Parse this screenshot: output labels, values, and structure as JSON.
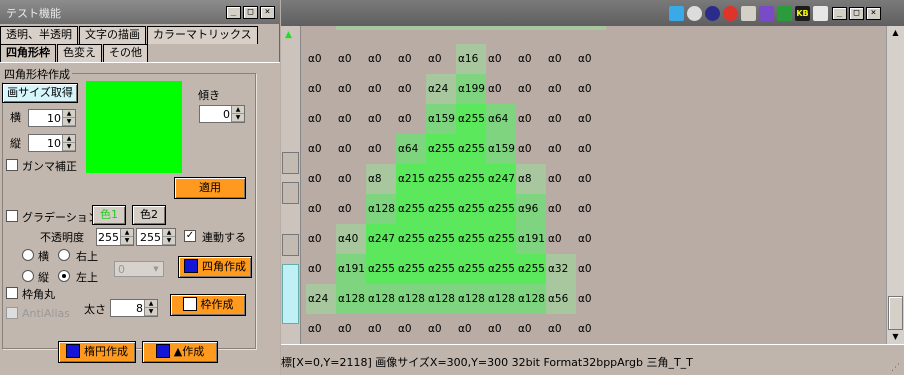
{
  "tool_window": {
    "title": "テスト機能",
    "tabs_row1": [
      "透明、半透明",
      "文字の描画",
      "カラーマトリックス"
    ],
    "tabs_row2": [
      "四角形枠",
      "色変え",
      "その他"
    ],
    "group_title": "四角形枠作成",
    "image_size_button": "画サイズ取得",
    "tilt_label": "傾き",
    "tilt_value": "0",
    "width_label": "横",
    "width_value": "10",
    "height_label": "縦",
    "height_value": "10",
    "gamma_label": "ガンマ補正",
    "apply_button": "適用",
    "gradation_label": "グラデーション",
    "color1_button": "色1",
    "color2_button": "色2",
    "opacity_label": "不透明度",
    "opacity1": "255",
    "opacity2": "255",
    "linked_label": "連動する",
    "dir_horizontal": "横",
    "dir_upper_right": "右上",
    "dir_vertical": "縦",
    "dir_upper_left": "左上",
    "dropdown_value": "0",
    "make_rect_button": "四角作成",
    "round_corner_label": "枠角丸",
    "antialias_label": "AntiAlias",
    "thickness_label": "太さ",
    "thickness_value": "8",
    "make_frame_button": "枠作成",
    "make_ellipse_button": "楕円作成",
    "make_triangle_button": "▲作成",
    "colors": {
      "preview": "#00ff00",
      "apply_button": "#ff9a1e"
    }
  },
  "viewer": {
    "status": "標[X=0,Y=2118] 画像サイズX=300,Y=300 32bit Format32bppArgb 三角_T_T",
    "grid": [
      [
        "α0",
        "α0",
        "α0",
        "α0",
        "α16",
        "α0",
        "α0",
        "α0",
        "α0"
      ],
      [
        "α0",
        "α0",
        "α0",
        "α24",
        "α199",
        "α0",
        "α0",
        "α0",
        "α0"
      ],
      [
        "α0",
        "α0",
        "α0",
        "α159",
        "α255",
        "α64",
        "α0",
        "α0",
        "α0"
      ],
      [
        "α0",
        "α0",
        "α64",
        "α255",
        "α255",
        "α159",
        "α0",
        "α0",
        "α0"
      ],
      [
        "α0",
        "α8",
        "α215",
        "α255",
        "α255",
        "α247",
        "α8",
        "α0",
        "α0"
      ],
      [
        "α0",
        "α128",
        "α255",
        "α255",
        "α255",
        "α255",
        "α96",
        "α0",
        "α0"
      ],
      [
        "α40",
        "α247",
        "α255",
        "α255",
        "α255",
        "α255",
        "α191",
        "α0",
        "α0"
      ],
      [
        "α191",
        "α255",
        "α255",
        "α255",
        "α255",
        "α255",
        "α255",
        "α32",
        "α0"
      ],
      [
        "α128",
        "α128",
        "α128",
        "α128",
        "α128",
        "α128",
        "α128",
        "α56",
        "α0"
      ],
      [
        "α0",
        "α0",
        "α0",
        "α0",
        "α0",
        "α0",
        "α0",
        "α0",
        "α0"
      ]
    ],
    "first_col": [
      "α0",
      "α0",
      "α0",
      "α0",
      "α0",
      "α0",
      "α0",
      "α0",
      "α24",
      "α0"
    ],
    "cell_colors": {
      "full": "#5ce85c",
      "partial": "#7fd47f",
      "faint": "#a9c79f"
    }
  }
}
